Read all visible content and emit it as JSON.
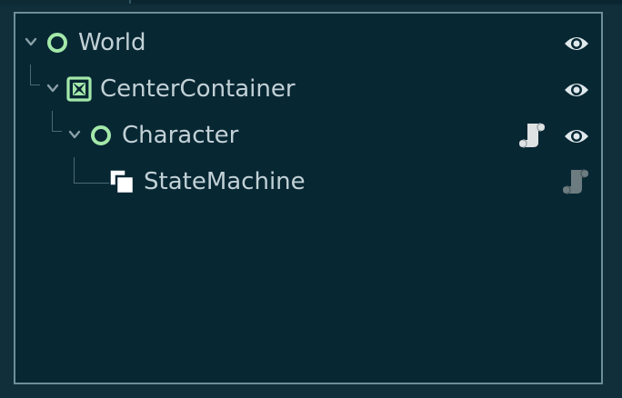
{
  "scene_tree": {
    "nodes": [
      {
        "label": "World",
        "icon": "node2d-circle-icon",
        "depth": 0,
        "expanded": true,
        "has_script": false,
        "script_active": false,
        "visible": true
      },
      {
        "label": "CenterContainer",
        "icon": "center-container-icon",
        "depth": 1,
        "expanded": true,
        "has_script": false,
        "script_active": false,
        "visible": true
      },
      {
        "label": "Character",
        "icon": "node2d-circle-icon",
        "depth": 2,
        "expanded": true,
        "has_script": true,
        "script_active": true,
        "visible": true
      },
      {
        "label": "StateMachine",
        "icon": "node-stack-icon",
        "depth": 3,
        "expanded": false,
        "has_script": true,
        "script_active": false,
        "visible": false
      }
    ]
  },
  "colors": {
    "background": "#072733",
    "border": "#6d8f99",
    "label": "#c2d1d6",
    "node_green": "#a3e8a9",
    "eye": "#dfe9ec",
    "script_active": "#dfe2e3",
    "script_inactive": "#6d7c80",
    "guide": "#4b6a74",
    "arrow": "#8aa0a7"
  }
}
